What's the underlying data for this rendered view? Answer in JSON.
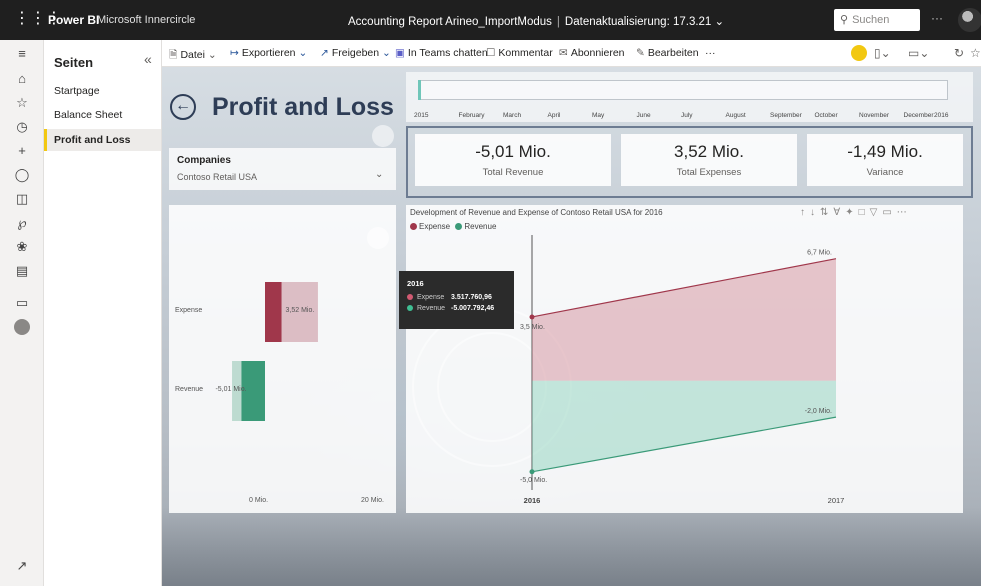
{
  "topbar": {
    "brand": "Power BI",
    "org": "Microsoft Innercircle",
    "report_title": "Accounting Report Arineo_ImportModus",
    "separator": "|",
    "refresh": "Datenaktualisierung: 17.3.21",
    "search_placeholder": "Suchen"
  },
  "pages": {
    "header": "Seiten",
    "items": [
      {
        "label": "Startpage"
      },
      {
        "label": "Balance Sheet"
      },
      {
        "label": "Profit and Loss",
        "active": true
      }
    ]
  },
  "toolbar": {
    "file": "Datei",
    "export": "Exportieren",
    "share": "Freigeben",
    "teams": "In Teams chatten",
    "comment": "Kommentar",
    "subscribe": "Abonnieren",
    "edit": "Bearbeiten",
    "more": "···"
  },
  "report": {
    "title": "Profit and Loss",
    "slicer": {
      "label": "Companies",
      "value": "Contoso Retail USA"
    },
    "timeline": {
      "labels": [
        "2015",
        "February",
        "March",
        "April",
        "May",
        "June",
        "July",
        "August",
        "September",
        "October",
        "November",
        "December",
        "2016"
      ]
    },
    "kpis": [
      {
        "value": "-5,01 Mio.",
        "label": "Total Revenue"
      },
      {
        "value": "3,52 Mio.",
        "label": "Total Expenses"
      },
      {
        "value": "-1,49 Mio.",
        "label": "Variance"
      }
    ]
  },
  "colors": {
    "expense": "#a0374b",
    "revenue": "#3a9a78",
    "title": "#2e3d56"
  },
  "chart_data": [
    {
      "type": "bar",
      "orientation": "horizontal",
      "categories": [
        "Expense",
        "Revenue"
      ],
      "values": [
        3.52,
        -5.01
      ],
      "data_labels": [
        "3,52 Mio.",
        "-5,01 Mio."
      ],
      "x_tick_labels": [
        "0 Mio.",
        "20 Mio."
      ]
    },
    {
      "type": "area",
      "title": "Development of Revenue and Expense of Contoso Retail USA for 2016",
      "categories": [
        "2016",
        "2017"
      ],
      "series": [
        {
          "name": "Expense",
          "values": [
            3.5,
            6.7
          ],
          "data_labels": [
            "3,5 Mio.",
            "6,7 Mio."
          ]
        },
        {
          "name": "Revenue",
          "values": [
            -5.0,
            -2.0
          ],
          "data_labels": [
            "-5,0 Mio.",
            "-2,0 Mio."
          ]
        }
      ],
      "tooltip": {
        "header": "2016",
        "rows": [
          {
            "name": "Expense",
            "value": "3.517.760,96"
          },
          {
            "name": "Revenue",
            "value": "-5.007.792,46"
          }
        ]
      }
    }
  ]
}
